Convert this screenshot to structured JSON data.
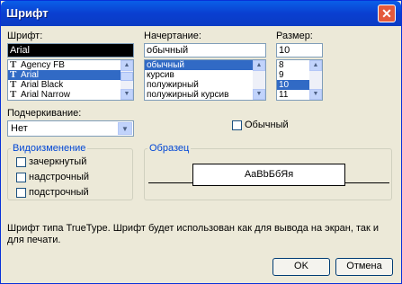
{
  "window": {
    "title": "Шрифт",
    "close_glyph": "✕"
  },
  "font": {
    "label": "Шрифт:",
    "value": "Arial",
    "items": [
      {
        "label": "Agency FB",
        "selected": false
      },
      {
        "label": "Arial",
        "selected": true
      },
      {
        "label": "Arial Black",
        "selected": false
      },
      {
        "label": "Arial Narrow",
        "selected": false
      }
    ]
  },
  "style": {
    "label": "Начертание:",
    "value": "обычный",
    "items": [
      {
        "label": "обычный",
        "selected": true
      },
      {
        "label": "курсив",
        "selected": false
      },
      {
        "label": "полужирный",
        "selected": false
      },
      {
        "label": "полужирный курсив",
        "selected": false
      }
    ]
  },
  "size": {
    "label": "Размер:",
    "value": "10",
    "items": [
      {
        "label": "8",
        "selected": false
      },
      {
        "label": "9",
        "selected": false
      },
      {
        "label": "10",
        "selected": true
      },
      {
        "label": "11",
        "selected": false
      }
    ]
  },
  "underline": {
    "label": "Подчеркивание:",
    "value": "Нет"
  },
  "normal_checkbox": {
    "label": "Обычный",
    "checked": false
  },
  "modification": {
    "title": "Видоизменение",
    "strike_label": "зачеркнутый",
    "super_label": "надстрочный",
    "sub_label": "подстрочный"
  },
  "preview": {
    "title": "Образец",
    "sample": "AaBbБбЯя"
  },
  "description": "Шрифт типа TrueType. Шрифт будет использован как для вывода на экран, так и для печати.",
  "buttons": {
    "ok": "OK",
    "cancel": "Отмена"
  },
  "icons": {
    "truetype": "truetype-icon"
  }
}
